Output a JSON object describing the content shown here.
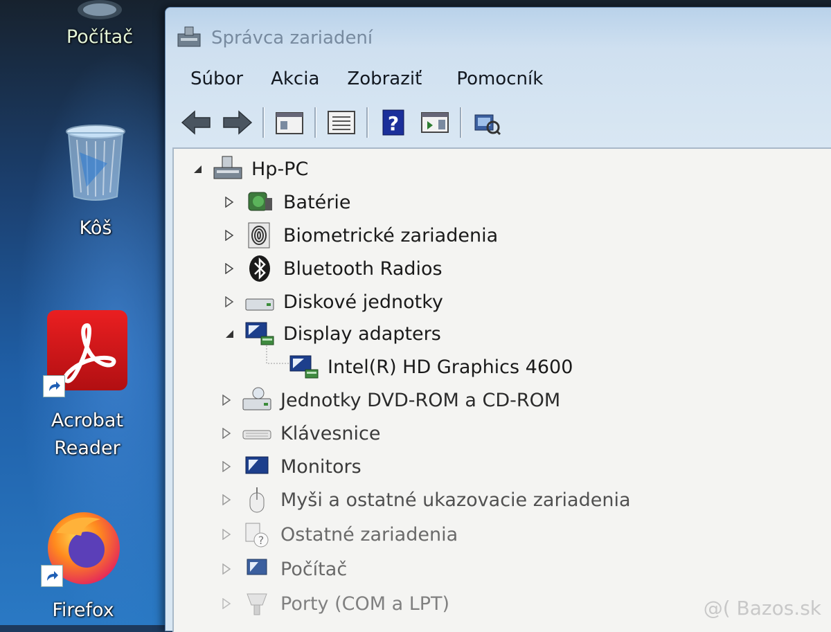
{
  "desktop": {
    "icons": [
      {
        "label": "Počítač"
      },
      {
        "label": "Kôš"
      },
      {
        "label": "Acrobat\nReader"
      },
      {
        "label": "Firefox"
      }
    ]
  },
  "window": {
    "title": "Správca zariadení",
    "menu": [
      "Súbor",
      "Akcia",
      "Zobraziť",
      "Pomocník"
    ],
    "toolbar": [
      "back-icon",
      "forward-icon",
      "properties-icon",
      "console-tree-icon",
      "help-icon",
      "action-pane-icon",
      "scan-hardware-icon"
    ]
  },
  "tree": {
    "root": "Hp-PC",
    "items": [
      {
        "label": "Batérie",
        "expanded": false
      },
      {
        "label": "Biometrické zariadenia",
        "expanded": false
      },
      {
        "label": "Bluetooth Radios",
        "expanded": false
      },
      {
        "label": "Diskové jednotky",
        "expanded": false
      },
      {
        "label": "Display adapters",
        "expanded": true
      },
      {
        "label": "Intel(R) HD Graphics 4600",
        "child": true
      },
      {
        "label": "Jednotky DVD-ROM a CD-ROM",
        "expanded": false
      },
      {
        "label": "Klávesnice",
        "expanded": false
      },
      {
        "label": "Monitors",
        "expanded": false
      },
      {
        "label": "Myši a ostatné ukazovacie zariadenia",
        "expanded": false
      },
      {
        "label": "Ostatné zariadenia",
        "expanded": false
      },
      {
        "label": "Počítač",
        "expanded": false
      },
      {
        "label": "Porty (COM a LPT)",
        "expanded": false
      }
    ]
  },
  "watermark": "@( Bazos.sk"
}
